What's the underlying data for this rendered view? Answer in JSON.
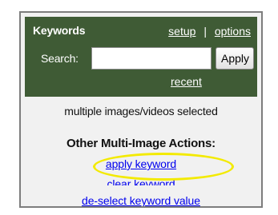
{
  "panel": {
    "title": "Keywords",
    "links": {
      "setup": "setup",
      "separator": "|",
      "options": "options"
    },
    "search": {
      "label": "Search:",
      "value": "",
      "placeholder": ""
    },
    "apply_button": "Apply",
    "recent_link": "recent"
  },
  "content": {
    "status": "multiple images/videos selected",
    "section_title": "Other Multi-Image Actions:",
    "actions": [
      {
        "label": "apply keyword"
      },
      {
        "label": "clear keyword"
      },
      {
        "label": "de-select keyword value"
      }
    ]
  },
  "colors": {
    "header_bg": "#3f5b35",
    "panel_bg": "#f1f1f1",
    "link_blue": "#0000ee",
    "highlight_yellow": "#f3ea00"
  }
}
